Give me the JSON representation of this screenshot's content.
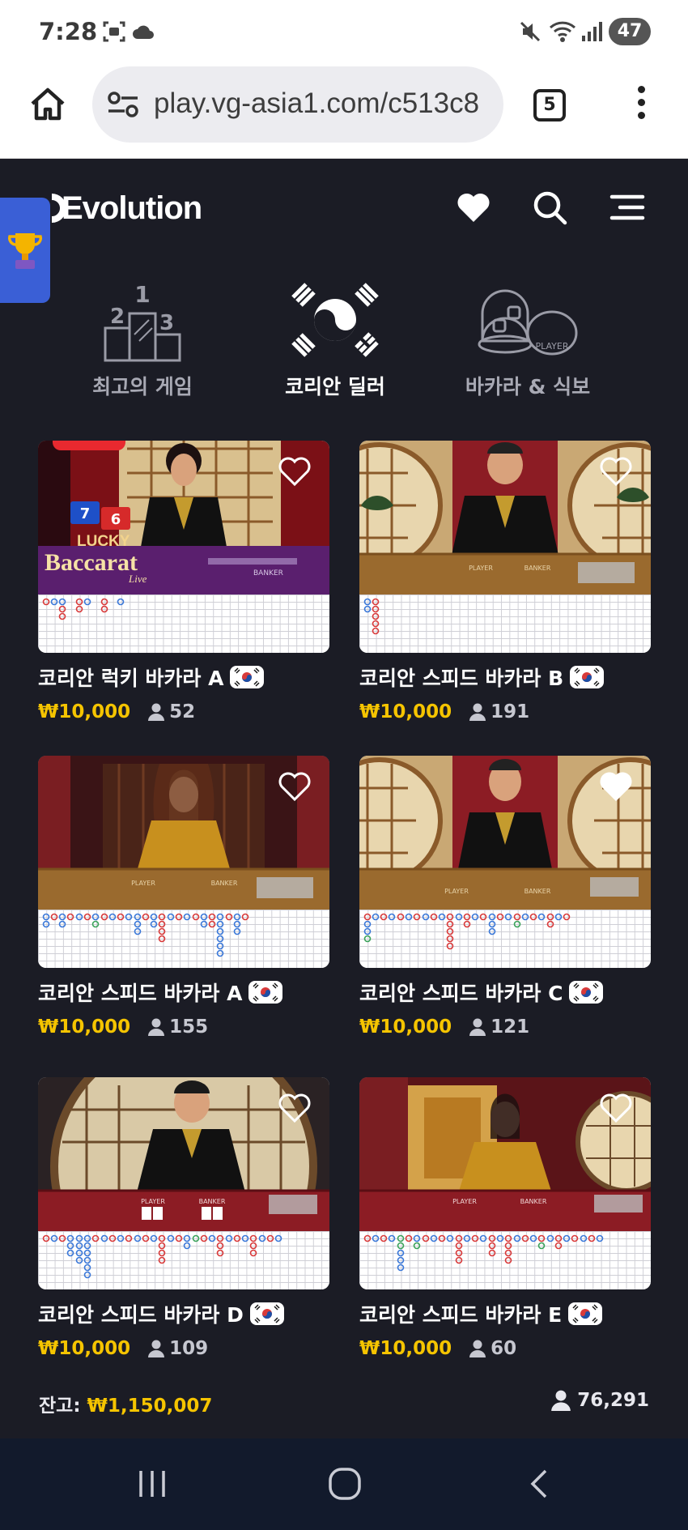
{
  "status": {
    "time": "7:28",
    "battery": "47"
  },
  "browser": {
    "url": "play.vg-asia1.com/c513c8",
    "tab_count": "5"
  },
  "brand": {
    "name": "Evolution"
  },
  "categories": [
    {
      "label": "최고의 게임",
      "active": false
    },
    {
      "label": "코리안 딜러",
      "active": true
    },
    {
      "label": "바카라 & 식보",
      "active": false
    }
  ],
  "tables": [
    {
      "name": "코리안 럭키 바카라 A",
      "price": "₩10,000",
      "players": "52",
      "favorite": false,
      "felt": "purple",
      "logo": "LUCKY Baccarat"
    },
    {
      "name": "코리안 스피드 바카라 B",
      "price": "₩10,000",
      "players": "191",
      "favorite": false,
      "felt": "brown"
    },
    {
      "name": "코리안 스피드 바카라 A",
      "price": "₩10,000",
      "players": "155",
      "favorite": false,
      "felt": "brown"
    },
    {
      "name": "코리안 스피드 바카라 C",
      "price": "₩10,000",
      "players": "121",
      "favorite": true,
      "felt": "brown"
    },
    {
      "name": "코리안 스피드 바카라 D",
      "price": "₩10,000",
      "players": "109",
      "favorite": false,
      "felt": "red"
    },
    {
      "name": "코리안 스피드 바카라 E",
      "price": "₩10,000",
      "players": "60",
      "favorite": false,
      "felt": "red"
    }
  ],
  "table_labels": {
    "player": "PLAYER",
    "banker": "BANKER",
    "lucky": "LUCKY",
    "baccarat": "Baccarat",
    "live": "Live",
    "card1": "7",
    "card2": "6",
    "cat_player": "PLAYER"
  },
  "footer": {
    "balance_label": "잔고:",
    "balance": "₩1,150,007",
    "total_players": "76,291"
  },
  "colors": {
    "background": "#1b1c25",
    "price": "#f5c400",
    "banker": "#d93a3a",
    "player": "#3a78d9",
    "tie": "#3aa35a",
    "nav": "#121a2c"
  }
}
